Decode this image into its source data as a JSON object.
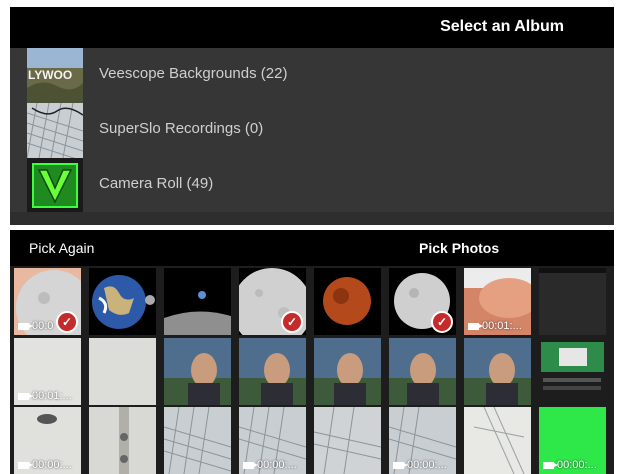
{
  "album_panel": {
    "title": "Select an Album",
    "albums": [
      {
        "label": "Veescope Backgrounds (22)",
        "thumb_icon": "hollywood-sign-thumbnail"
      },
      {
        "label": "SuperSlo Recordings (0)",
        "thumb_icon": "keyboard-thumbnail"
      },
      {
        "label": "Camera Roll (49)",
        "thumb_icon": "veescope-logo-thumbnail"
      }
    ]
  },
  "picker": {
    "pick_again_label": "Pick Again",
    "pick_photos_label": "Pick Photos",
    "video_durations": {
      "r1c1": "00:0",
      "r1c7": "00:01:...",
      "r2c1": "00:01:...",
      "r3c1": "00:00:...",
      "r3c4": "00:00:...",
      "r3c6": "00:00:...",
      "r3c8": "00:00:..."
    }
  },
  "colors": {
    "header_bg": "#000000",
    "panel_bg": "#363636",
    "checkmark": "#c62b2b",
    "green_screen": "#2ee84a"
  }
}
